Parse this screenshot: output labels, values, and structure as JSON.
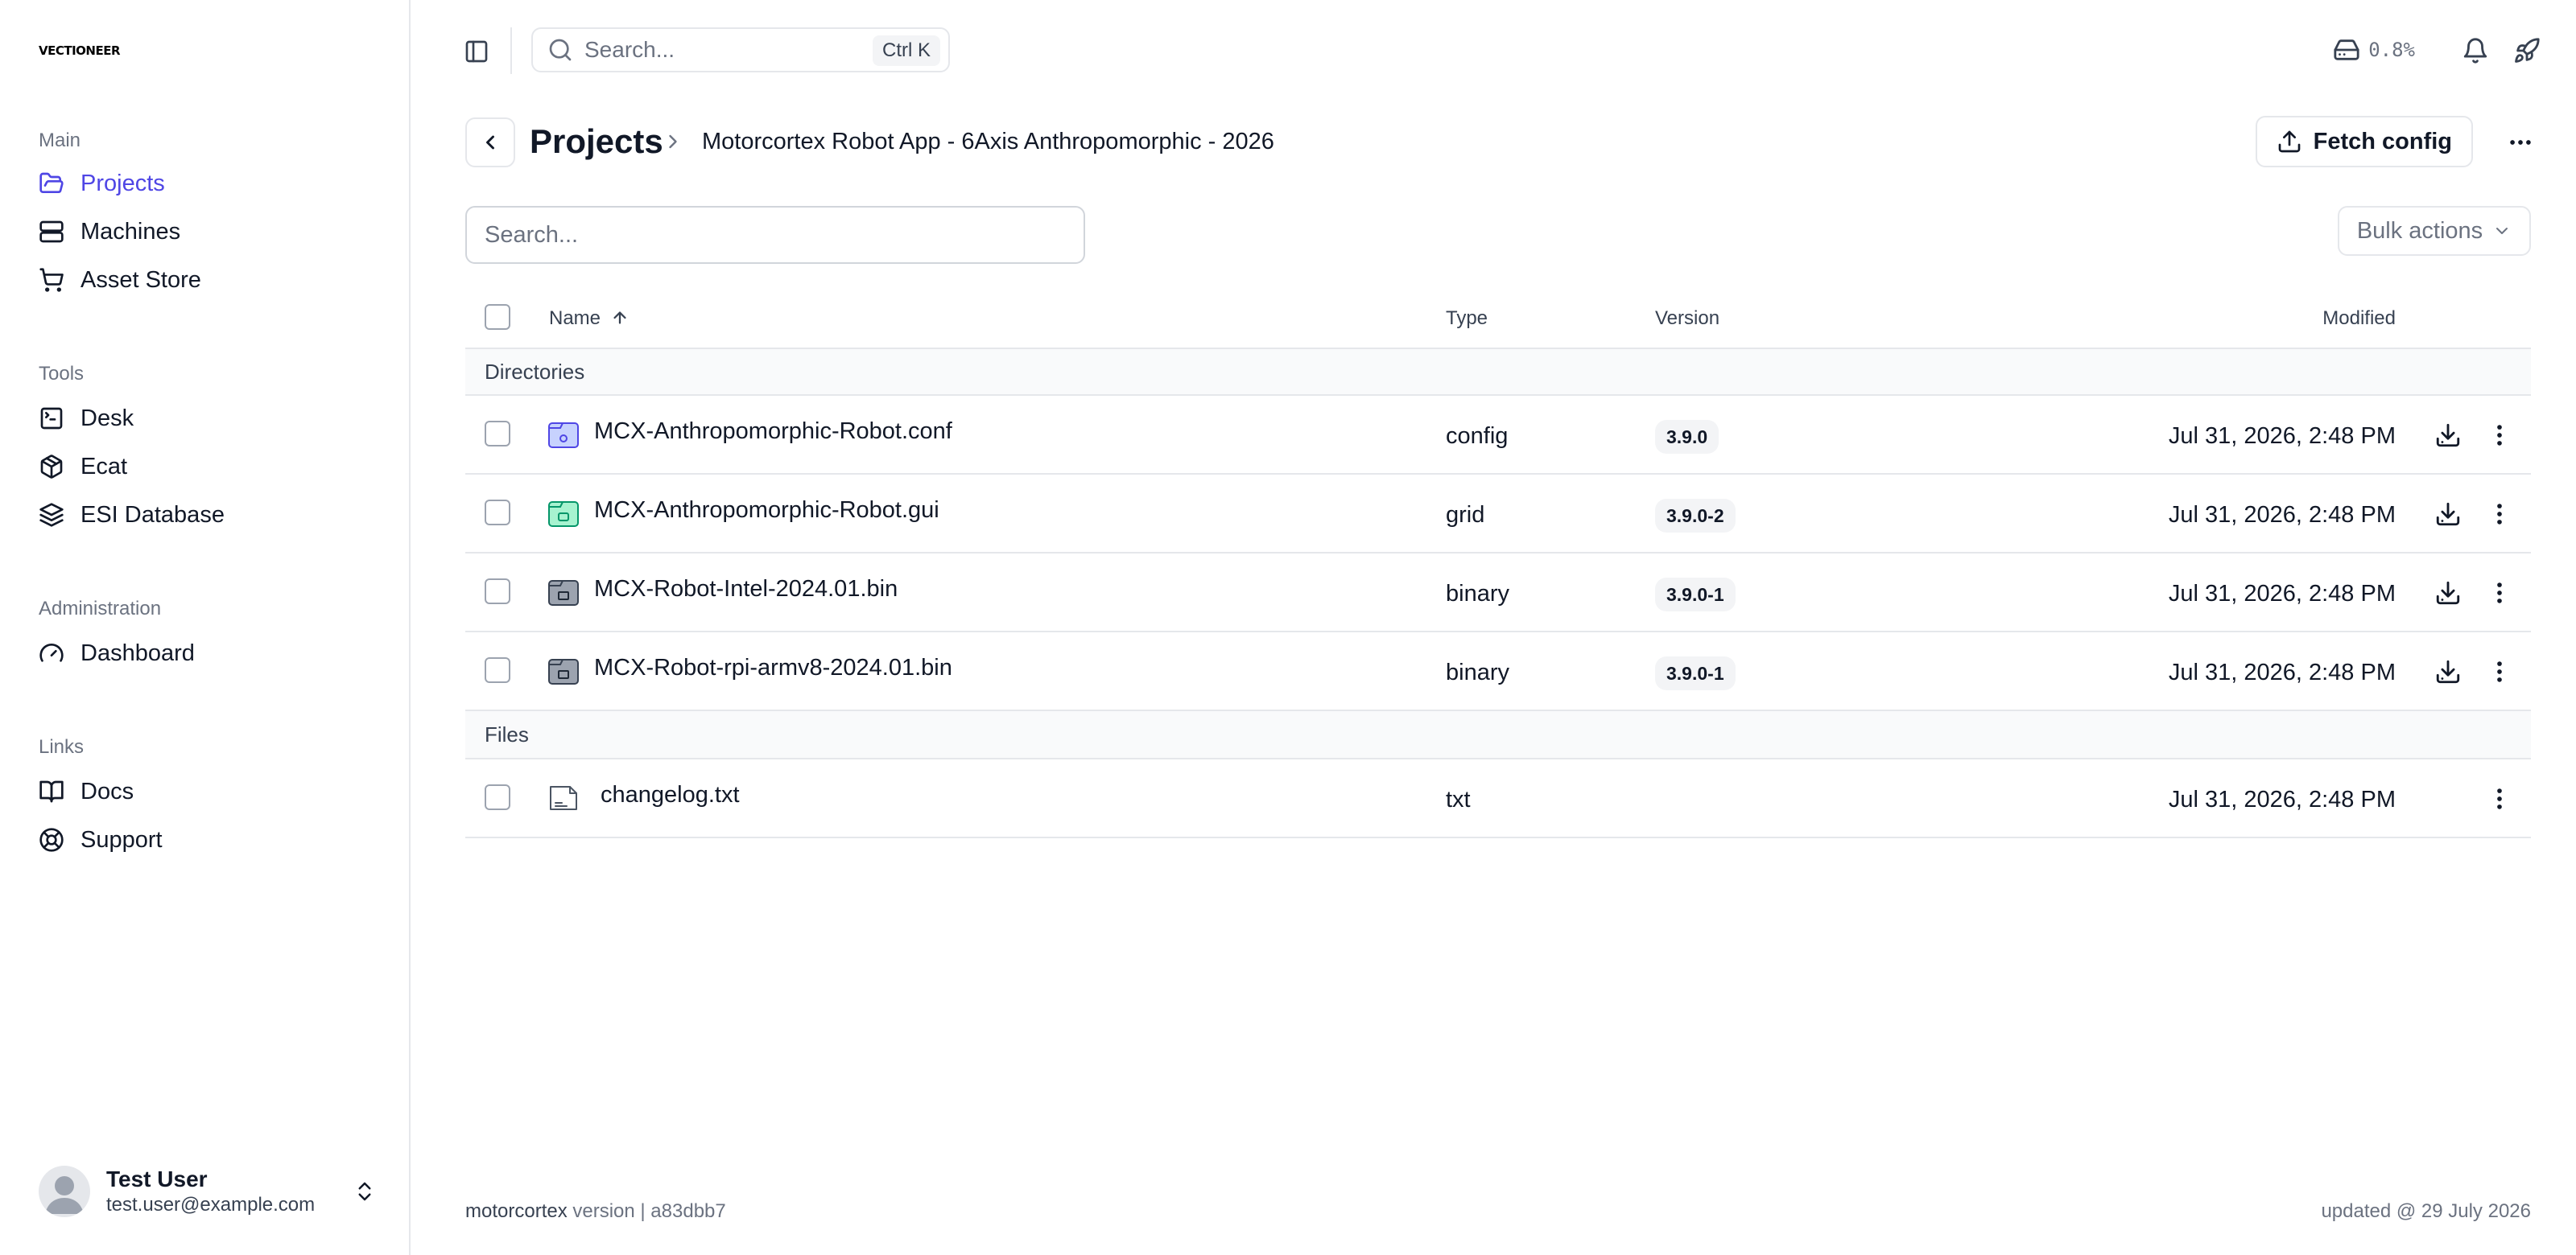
{
  "brand": {
    "logo_text": "VECTIONEER"
  },
  "sidebar": {
    "sections": [
      {
        "heading": "Main",
        "items": [
          {
            "label": "Projects",
            "icon": "folder-open-icon",
            "active": true
          },
          {
            "label": "Machines",
            "icon": "server-icon"
          },
          {
            "label": "Asset Store",
            "icon": "cart-icon"
          }
        ]
      },
      {
        "heading": "Tools",
        "items": [
          {
            "label": "Desk",
            "icon": "terminal-square-icon"
          },
          {
            "label": "Ecat",
            "icon": "package-icon"
          },
          {
            "label": "ESI Database",
            "icon": "layers-icon"
          }
        ]
      },
      {
        "heading": "Administration",
        "items": [
          {
            "label": "Dashboard",
            "icon": "gauge-icon"
          }
        ]
      },
      {
        "heading": "Links",
        "items": [
          {
            "label": "Docs",
            "icon": "book-open-icon"
          },
          {
            "label": "Support",
            "icon": "life-buoy-icon"
          }
        ]
      }
    ],
    "user": {
      "name": "Test User",
      "email": "test.user@example.com"
    }
  },
  "topbar": {
    "search_placeholder": "Search...",
    "shortcut": "Ctrl K",
    "storage_usage": "0.8%"
  },
  "header": {
    "title": "Projects",
    "breadcrumb_current": "Motorcortex Robot App - 6Axis Anthropomorphic - 2026",
    "fetch_label": "Fetch config"
  },
  "toolbar": {
    "search_placeholder": "Search...",
    "bulk_label": "Bulk actions"
  },
  "table": {
    "columns": {
      "name": "Name",
      "type": "Type",
      "version": "Version",
      "modified": "Modified"
    },
    "groups": [
      {
        "label": "Directories",
        "rows": [
          {
            "name": "MCX-Anthropomorphic-Robot.conf",
            "type": "config",
            "version": "3.9.0",
            "modified": "Jul 31, 2026, 2:48 PM",
            "icon": "config-folder-icon",
            "color": "#818cf8"
          },
          {
            "name": "MCX-Anthropomorphic-Robot.gui",
            "type": "grid",
            "version": "3.9.0-2",
            "modified": "Jul 31, 2026, 2:48 PM",
            "icon": "gui-folder-icon",
            "color": "#34d399"
          },
          {
            "name": "MCX-Robot-Intel-2024.01.bin",
            "type": "binary",
            "version": "3.9.0-1",
            "modified": "Jul 31, 2026, 2:48 PM",
            "icon": "binary-folder-icon",
            "color": "#6b7280"
          },
          {
            "name": "MCX-Robot-rpi-armv8-2024.01.bin",
            "type": "binary",
            "version": "3.9.0-1",
            "modified": "Jul 31, 2026, 2:48 PM",
            "icon": "binary-folder-icon",
            "color": "#6b7280"
          }
        ]
      },
      {
        "label": "Files",
        "rows": [
          {
            "name": "changelog.txt",
            "type": "txt",
            "version": "",
            "modified": "Jul 31, 2026, 2:48 PM",
            "icon": "text-file-icon"
          }
        ]
      }
    ]
  },
  "footer": {
    "brand": "motorcortex",
    "version_text": " version | a83dbb7",
    "updated": "updated @ 29 July 2026"
  },
  "colors": {
    "accent": "#4f46e5",
    "border": "#e5e7eb"
  }
}
